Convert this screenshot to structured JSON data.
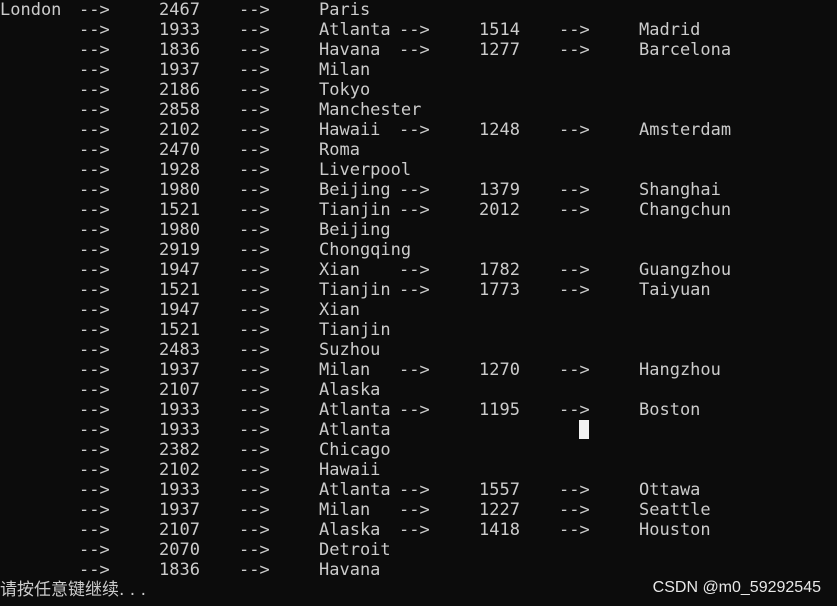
{
  "console": {
    "rows": [
      [
        "London",
        "-->",
        "2467",
        "-->",
        "Paris",
        "",
        "",
        "",
        ""
      ],
      [
        "",
        "-->",
        "1933",
        "-->",
        "Atlanta",
        "-->",
        "1514",
        "-->",
        "Madrid"
      ],
      [
        "",
        "-->",
        "1836",
        "-->",
        "Havana",
        "-->",
        "1277",
        "-->",
        "Barcelona"
      ],
      [
        "",
        "-->",
        "1937",
        "-->",
        "Milan",
        "",
        "",
        "",
        ""
      ],
      [
        "",
        "-->",
        "2186",
        "-->",
        "Tokyo",
        "",
        "",
        "",
        ""
      ],
      [
        "",
        "-->",
        "2858",
        "-->",
        "Manchester",
        "",
        "",
        "",
        ""
      ],
      [
        "",
        "-->",
        "2102",
        "-->",
        "Hawaii",
        "-->",
        "1248",
        "-->",
        "Amsterdam"
      ],
      [
        "",
        "-->",
        "2470",
        "-->",
        "Roma",
        "",
        "",
        "",
        ""
      ],
      [
        "",
        "-->",
        "1928",
        "-->",
        "Liverpool",
        "",
        "",
        "",
        ""
      ],
      [
        "",
        "-->",
        "1980",
        "-->",
        "Beijing",
        "-->",
        "1379",
        "-->",
        "Shanghai"
      ],
      [
        "",
        "-->",
        "1521",
        "-->",
        "Tianjin",
        "-->",
        "2012",
        "-->",
        "Changchun"
      ],
      [
        "",
        "-->",
        "1980",
        "-->",
        "Beijing",
        "",
        "",
        "",
        ""
      ],
      [
        "",
        "-->",
        "2919",
        "-->",
        "Chongqing",
        "",
        "",
        "",
        ""
      ],
      [
        "",
        "-->",
        "1947",
        "-->",
        "Xian",
        "-->",
        "1782",
        "-->",
        "Guangzhou"
      ],
      [
        "",
        "-->",
        "1521",
        "-->",
        "Tianjin",
        "-->",
        "1773",
        "-->",
        "Taiyuan"
      ],
      [
        "",
        "-->",
        "1947",
        "-->",
        "Xian",
        "",
        "",
        "",
        ""
      ],
      [
        "",
        "-->",
        "1521",
        "-->",
        "Tianjin",
        "",
        "",
        "",
        ""
      ],
      [
        "",
        "-->",
        "2483",
        "-->",
        "Suzhou",
        "",
        "",
        "",
        ""
      ],
      [
        "",
        "-->",
        "1937",
        "-->",
        "Milan",
        "-->",
        "1270",
        "-->",
        "Hangzhou"
      ],
      [
        "",
        "-->",
        "2107",
        "-->",
        "Alaska",
        "",
        "",
        "",
        ""
      ],
      [
        "",
        "-->",
        "1933",
        "-->",
        "Atlanta",
        "-->",
        "1195",
        "-->",
        "Boston"
      ],
      [
        "",
        "-->",
        "1933",
        "-->",
        "Atlanta",
        "",
        "",
        "",
        ""
      ],
      [
        "",
        "-->",
        "2382",
        "-->",
        "Chicago",
        "",
        "",
        "",
        ""
      ],
      [
        "",
        "-->",
        "2102",
        "-->",
        "Hawaii",
        "",
        "",
        "",
        ""
      ],
      [
        "",
        "-->",
        "1933",
        "-->",
        "Atlanta",
        "-->",
        "1557",
        "-->",
        "Ottawa"
      ],
      [
        "",
        "-->",
        "1937",
        "-->",
        "Milan",
        "-->",
        "1227",
        "-->",
        "Seattle"
      ],
      [
        "",
        "-->",
        "2107",
        "-->",
        "Alaska",
        "-->",
        "1418",
        "-->",
        "Houston"
      ],
      [
        "",
        "-->",
        "2070",
        "-->",
        "Detroit",
        "",
        "",
        "",
        ""
      ],
      [
        "",
        "-->",
        "1836",
        "-->",
        "Havana",
        "",
        "",
        "",
        ""
      ]
    ],
    "prompt": "请按任意键继续. . .",
    "watermark": "CSDN @m0_59292545"
  },
  "colors": {
    "background": "#0c0c0c",
    "text": "#cccccc",
    "cursor": "#f2f2f2"
  }
}
